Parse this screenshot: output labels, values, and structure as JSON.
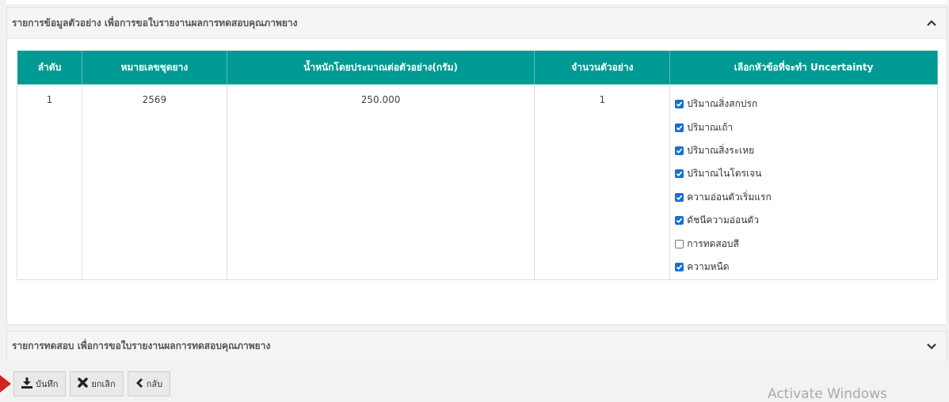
{
  "panel1": {
    "title": "รายการข้อมูลตัวอย่าง เพื่อการขอใบรายงานผลการทดสอบคุณภาพยาง"
  },
  "table": {
    "headers": [
      "ลำดับ",
      "หมายเลขชุดยาง",
      "น้ำหนักโดยประมาณต่อตัวอย่าง(กรัม)",
      "จำนวนตัวอย่าง",
      "เลือกหัวข้อที่จะทำ Uncertainty"
    ],
    "row": {
      "seq": "1",
      "lot": "2569",
      "weight": "250.000",
      "count": "1",
      "options": [
        {
          "label": "ปริมาณสิ่งสกปรก",
          "checked": true
        },
        {
          "label": "ปริมาณเถ้า",
          "checked": true
        },
        {
          "label": "ปริมาณสิ่งระเหย",
          "checked": true
        },
        {
          "label": "ปริมาณไนโตรเจน",
          "checked": true
        },
        {
          "label": "ความอ่อนตัวเริ่มแรก",
          "checked": true
        },
        {
          "label": "ดัชนีความอ่อนตัว",
          "checked": true
        },
        {
          "label": "การทดสอบสี",
          "checked": false
        },
        {
          "label": "ความหนืด",
          "checked": true
        }
      ]
    }
  },
  "panel2": {
    "title": "รายการทดสอบ เพื่อการขอใบรายงานผลการทดสอบคุณภาพยาง"
  },
  "buttons": {
    "save": "บันทึก",
    "cancel": "ยกเลิก",
    "back": "กลับ"
  },
  "watermark": "Activate Windows",
  "colors": {
    "header": "#009a94",
    "checkbox": "#1a6fd1",
    "arrow": "#d32222"
  }
}
